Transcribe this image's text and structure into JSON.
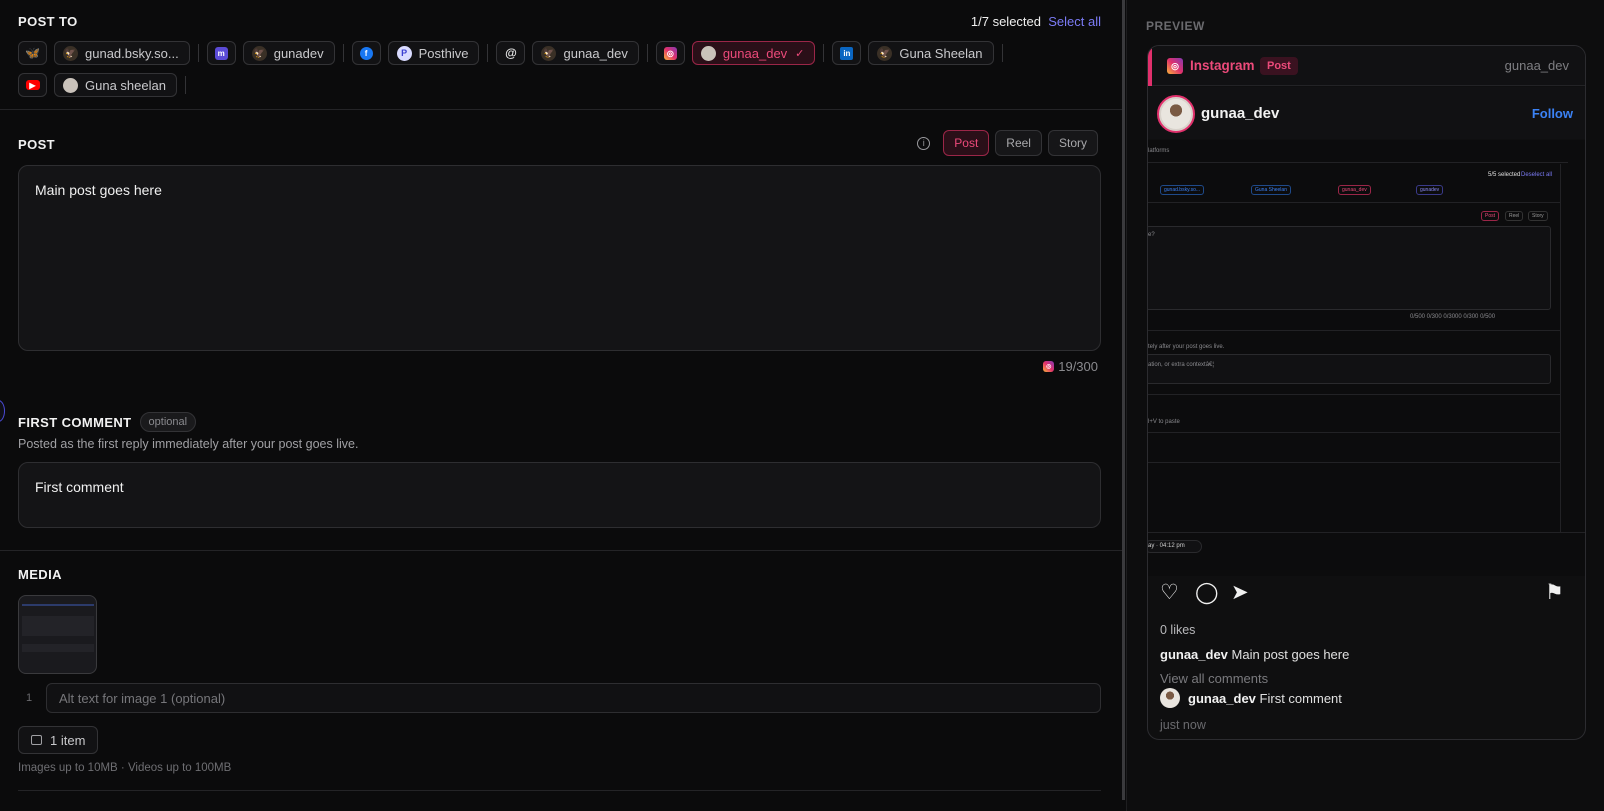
{
  "post_to": {
    "title": "POST TO",
    "selected_count": "1/7 selected",
    "select_all": "Select all",
    "row1": [
      {
        "platform": "bluesky",
        "icon": "butterfly-icon",
        "label": "gunad.bsky.so..."
      },
      {
        "platform": "mastodon",
        "icon": "mastodon-icon",
        "label": "gunadev"
      },
      {
        "platform": "facebook",
        "icon": "facebook-icon",
        "label": "Posthive"
      },
      {
        "platform": "threads",
        "icon": "threads-icon",
        "label": "gunaa_dev"
      },
      {
        "platform": "instagram",
        "icon": "instagram-icon",
        "label": "gunaa_dev",
        "selected": true
      },
      {
        "platform": "linkedin",
        "icon": "linkedin-icon",
        "label": "Guna Sheelan"
      }
    ],
    "row2": [
      {
        "platform": "youtube",
        "icon": "youtube-icon",
        "label": "Guna sheelan"
      }
    ]
  },
  "post": {
    "title": "POST",
    "types": [
      "Post",
      "Reel",
      "Story"
    ],
    "active_type": "Post",
    "text": "Main post goes here",
    "counter": "19/300"
  },
  "first_comment": {
    "title": "FIRST COMMENT",
    "badge": "optional",
    "description": "Posted as the first reply immediately after your post goes live.",
    "text": "First comment"
  },
  "media": {
    "title": "MEDIA",
    "index": "1",
    "alt_placeholder": "Alt text for image 1 (optional)",
    "items_label": "1 item",
    "limits": "Images up to 10MB · Videos up to 100MB"
  },
  "preview": {
    "label": "PREVIEW",
    "platform": "Instagram",
    "badge": "Post",
    "handle": "gunaa_dev",
    "username": "gunaa_dev",
    "follow": "Follow",
    "likes": "0 likes",
    "caption_user": "gunaa_dev",
    "caption_text": "Main post goes here",
    "view_all": "View all comments",
    "comment_user": "gunaa_dev",
    "comment_text": "First comment",
    "time": "just now",
    "mini": {
      "platforms": "latforms",
      "selected": "5/5 selected",
      "deselect": "Deselect all",
      "chips": [
        "gunad.bsky.so...",
        "Guna Sheelan",
        "gunaa_dev",
        "gunadev"
      ],
      "types": [
        "Post",
        "Reel",
        "Story"
      ],
      "q": "e?",
      "counters": "0/500  0/300  0/3000  0/300  0/500",
      "fc_desc": "tely after your post goes live.",
      "fc_placeholder": "ation, or extra contextâ€¦",
      "paste": "l+V to paste",
      "schedule": "ay · 04:12 pm"
    }
  },
  "colors": {
    "accent_pink": "#ec4a7a",
    "link_blue": "#3b82f6",
    "select_all": "#7b7bf5"
  }
}
